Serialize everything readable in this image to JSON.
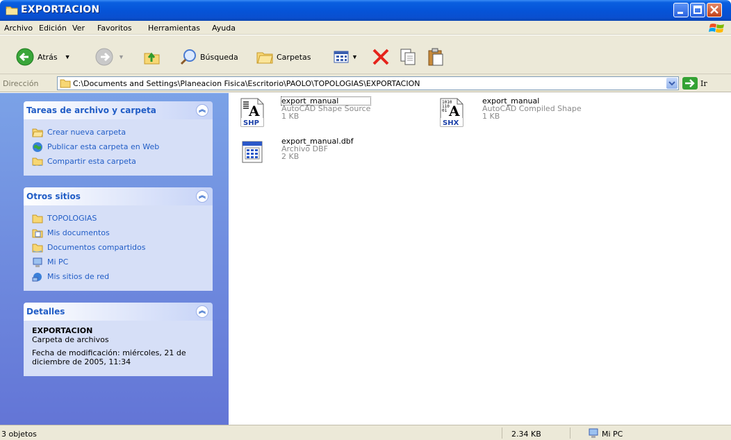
{
  "window": {
    "title": "EXPORTACION"
  },
  "menu": {
    "items": [
      "Archivo",
      "Edición",
      "Ver",
      "Favoritos",
      "Herramientas",
      "Ayuda"
    ]
  },
  "toolbar": {
    "back_label": "Atrás",
    "search_label": "Búsqueda",
    "folders_label": "Carpetas"
  },
  "address": {
    "label": "Dirección",
    "path": "C:\\Documents and Settings\\Planeacion Fisica\\Escritorio\\PAOLO\\TOPOLOGIAS\\EXPORTACION",
    "go_label": "Ir"
  },
  "panels": {
    "tasks": {
      "title": "Tareas de archivo y carpeta",
      "items": [
        "Crear nueva carpeta",
        "Publicar esta carpeta en Web",
        "Compartir esta carpeta"
      ]
    },
    "other": {
      "title": "Otros sitios",
      "items": [
        "TOPOLOGIAS",
        "Mis documentos",
        "Documentos compartidos",
        "Mi PC",
        "Mis sitios de red"
      ]
    },
    "details": {
      "title": "Detalles",
      "name": "EXPORTACION",
      "type": "Carpeta de archivos",
      "modified": "Fecha de modificación: miércoles, 21 de diciembre de 2005, 11:34"
    }
  },
  "files": [
    {
      "name": "export_manual",
      "type": "AutoCAD Shape Source",
      "size": "1 KB",
      "icon": "shp-file-icon",
      "badge": "SHP"
    },
    {
      "name": "export_manual",
      "type": "AutoCAD Compiled Shape",
      "size": "1 KB",
      "icon": "shx-file-icon",
      "badge": "SHX"
    },
    {
      "name": "export_manual.dbf",
      "type": "Archivo DBF",
      "size": "2 KB",
      "icon": "dbf-file-icon"
    }
  ],
  "status": {
    "objects": "3 objetos",
    "size": "2.34 KB",
    "location": "Mi PC"
  },
  "colors": {
    "titlebar": "#0554d8",
    "link": "#215dc6",
    "pane_top": "#7ba2e7",
    "pane_bottom": "#6375d6"
  }
}
